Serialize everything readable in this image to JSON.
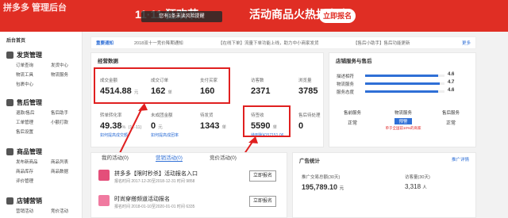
{
  "header": {
    "brand": "拼多多 管理后台",
    "banner_title": "11·11 狂欢节",
    "banner_tagline": "活动商品火热报名中",
    "banner_cta": "立即报名",
    "toast": "您有1条未读风险提醒"
  },
  "sidebar": {
    "home": "后台首页",
    "sections": [
      {
        "title": "发货管理",
        "items": [
          "订单查询",
          "发货中心",
          "物流工具",
          "物流服务",
          "包裹中心"
        ]
      },
      {
        "title": "售后管理",
        "items": [
          "退款/售后",
          "售后助手",
          "工单管理",
          "小额打款",
          "售后设置"
        ]
      },
      {
        "title": "商品管理",
        "items": [
          "发布新商品",
          "商品列表",
          "商品库存",
          "商品数据",
          "评价管理"
        ]
      },
      {
        "title": "店铺营销",
        "items": [
          "营销活动",
          "竞价活动"
        ]
      }
    ]
  },
  "notice": {
    "tag": "重要通知",
    "items": [
      "2018双十一竞价降期通知",
      "【在线下单】流量下单功能上线，助力中小商家发货",
      "【售后小助手】售后功能更新"
    ],
    "more": "更多"
  },
  "ops": {
    "title": "经营数据",
    "row1": [
      {
        "label": "成交金额",
        "value": "4514.88",
        "unit": "元"
      },
      {
        "label": "成交订单",
        "value": "162",
        "unit": "单"
      },
      {
        "label": "支付买家",
        "value": "160",
        "unit": ""
      },
      {
        "label": "访客数",
        "value": "2371",
        "unit": ""
      },
      {
        "label": "浏览量",
        "value": "3785",
        "unit": ""
      }
    ],
    "row2": [
      {
        "label": "转单转化率",
        "value": "49.38",
        "unit": "%",
        "sub": "(11-11)"
      },
      {
        "label": "未成团金额",
        "value": "0",
        "unit": "元",
        "sub": "如何提高成团率"
      },
      {
        "label": "待发货",
        "value": "1343",
        "unit": "单",
        "sub": ""
      },
      {
        "label": "待签收",
        "value": "5590",
        "unit": "单",
        "sub": "待到账¥157151.06"
      },
      {
        "label": "售后待处理",
        "value": "0",
        "unit": "",
        "sub": ""
      }
    ],
    "sub_link": "如何提高成交额"
  },
  "shop": {
    "title": "店铺服务与售后",
    "ratings": [
      {
        "label": "描述相符",
        "value": "4.6",
        "pct": 0.92
      },
      {
        "label": "物流服务",
        "value": "4.7",
        "pct": 0.94
      },
      {
        "label": "服务态度",
        "value": "4.6",
        "pct": 0.92
      }
    ],
    "status": [
      {
        "label": "售前服务",
        "value": "正常"
      },
      {
        "label": "物流服务",
        "value": "预警"
      },
      {
        "label": "售后服务",
        "value": "正常"
      }
    ],
    "warn": "单于全国前10%的商家"
  },
  "tabs": {
    "my": "我的活动(0)",
    "marketing": "营销活动(0)",
    "bidding": "竞价活动(0)"
  },
  "activities": [
    {
      "title": "拼多多【限时秒杀】活动报名入口",
      "date": "报名时间 2017-12-20至2018-12-31 时间 9858",
      "button": "立即报名"
    },
    {
      "title": "时尚穿搭频道活动报名",
      "date": "报名时间 2018-01-10至2020-01-01 时间 6335",
      "button": "立即报名"
    }
  ],
  "promo": {
    "title": "广告统计",
    "details": "推广详情",
    "gmv_label": "推广交易总额(30天)",
    "gmv_value": "195,789.10",
    "gmv_unit": "元",
    "visits_label": "访客量(30天)",
    "visits_value": "3,318",
    "visits_unit": "人"
  }
}
